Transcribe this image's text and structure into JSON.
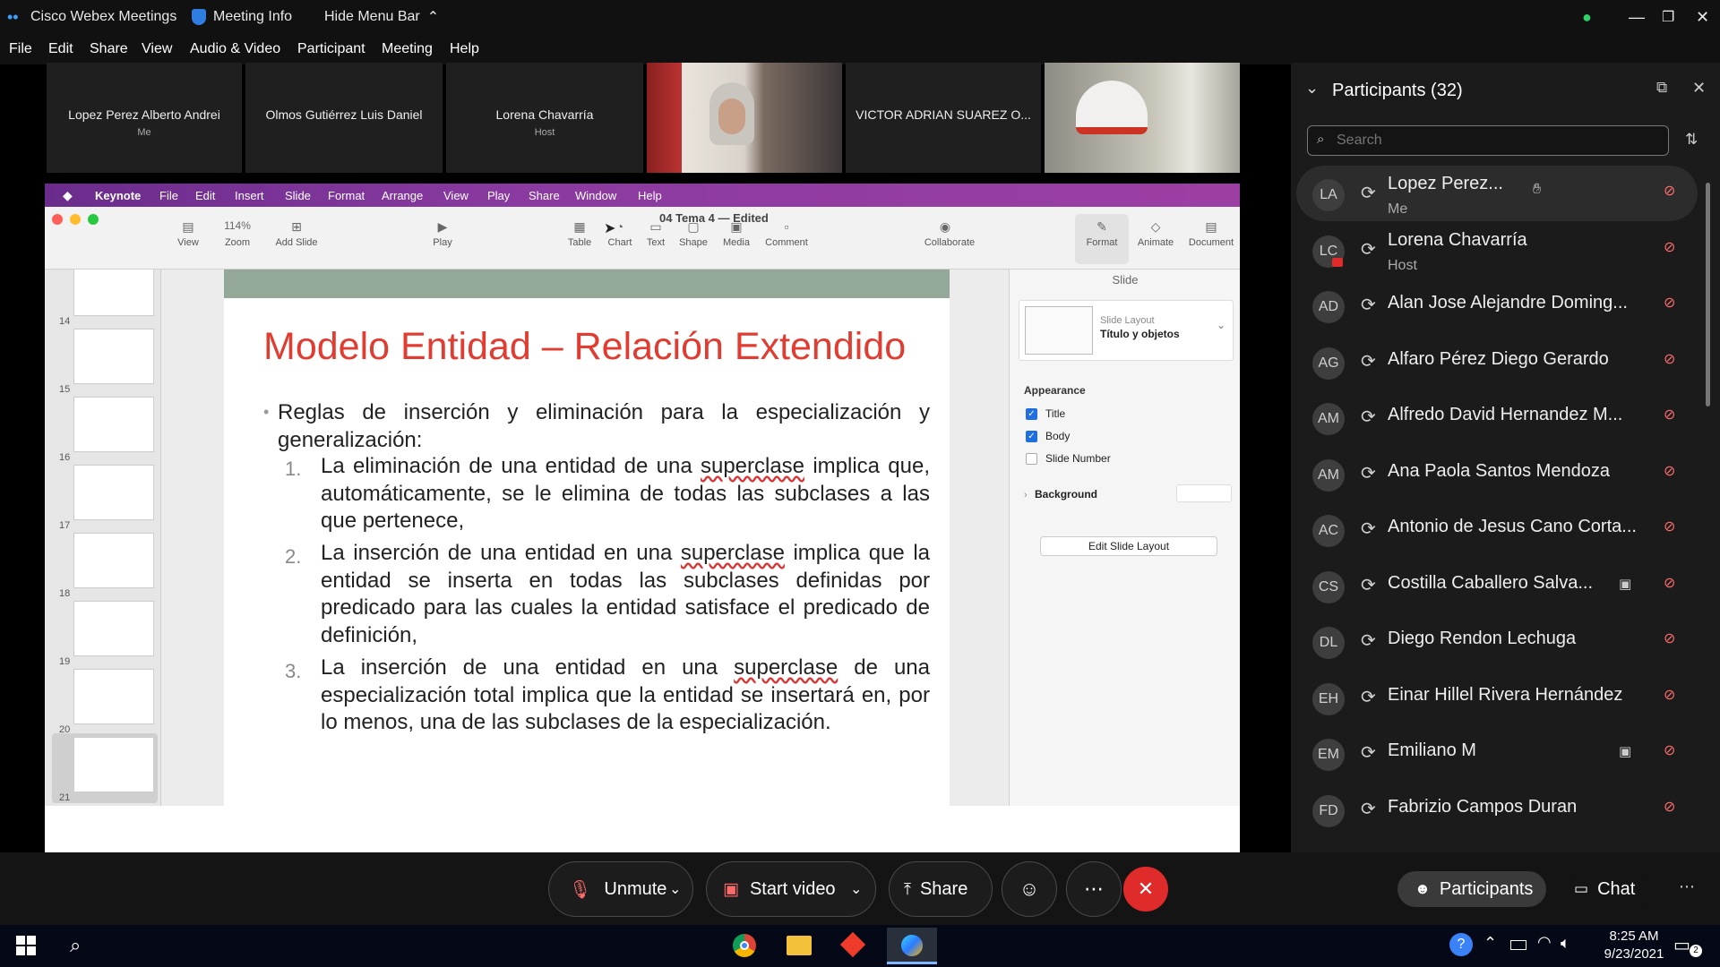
{
  "titlebar": {
    "app_name": "Cisco Webex Meetings",
    "meeting_info": "Meeting Info",
    "hide_menu": "Hide Menu Bar"
  },
  "menu": [
    "File",
    "Edit",
    "Share",
    "View",
    "Audio & Video",
    "Participant",
    "Meeting",
    "Help"
  ],
  "video_tiles": [
    {
      "name": "Lopez Perez Alberto Andrei",
      "sub": "Me"
    },
    {
      "name": "Olmos Gutiérrez Luis Daniel",
      "sub": ""
    },
    {
      "name": "Lorena Chavarría",
      "sub": "Host"
    },
    {
      "name": "",
      "sub": ""
    },
    {
      "name": "VICTOR ADRIAN SUAREZ O...",
      "sub": ""
    },
    {
      "name": "",
      "sub": ""
    }
  ],
  "keynote": {
    "menu": [
      "Keynote",
      "File",
      "Edit",
      "Insert",
      "Slide",
      "Format",
      "Arrange",
      "View",
      "Play",
      "Share",
      "Window",
      "Help"
    ],
    "doc_title": "04 Tema 4 — Edited",
    "toolbar": {
      "zoom_value": "114%",
      "view": "View",
      "zoom": "Zoom",
      "add_slide": "Add Slide",
      "play": "Play",
      "table": "Table",
      "chart": "Chart",
      "text": "Text",
      "shape": "Shape",
      "media": "Media",
      "comment": "Comment",
      "collaborate": "Collaborate",
      "format": "Format",
      "animate": "Animate",
      "document": "Document"
    },
    "thumb_numbers": [
      "14",
      "15",
      "16",
      "17",
      "18",
      "19",
      "20",
      "21"
    ],
    "slide": {
      "title": "Modelo Entidad – Relación Extendido",
      "bullet": "Reglas de inserción y eliminación para la especialización y generalización:",
      "items": [
        {
          "num": "1.",
          "a": "La eliminación de una entidad de una ",
          "sq": "superclase",
          "b": " implica que, automáticamente, se le elimina de todas las subclases a las que pertenece,"
        },
        {
          "num": "2.",
          "a": "La inserción de una entidad en una ",
          "sq": "superclase",
          "b": " implica que la entidad se inserta en todas las subclases definidas por predicado para las cuales la entidad satisface el predicado de definición,"
        },
        {
          "num": "3.",
          "a": "La inserción de una entidad en una ",
          "sq": "superclase",
          "b": " de una especialización total implica que la entidad se insertará en, por lo menos, una de las subclases de la especialización."
        }
      ]
    },
    "inspector": {
      "tab": "Slide",
      "layout_label": "Slide Layout",
      "layout_value": "Título y objetos",
      "appearance": "Appearance",
      "title_chk": "Title",
      "body_chk": "Body",
      "slide_number_chk": "Slide Number",
      "background": "Background",
      "edit_layout": "Edit Slide Layout"
    }
  },
  "participants_panel": {
    "title": "Participants (32)",
    "search_placeholder": "Search",
    "list": [
      {
        "initials": "LA",
        "name": "Lopez Perez...",
        "sub": "Me",
        "video": false
      },
      {
        "initials": "LC",
        "name": "Lorena Chavarría",
        "sub": "Host",
        "video": false
      },
      {
        "initials": "AD",
        "name": "Alan Jose Alejandre Doming...",
        "sub": "",
        "video": false
      },
      {
        "initials": "AG",
        "name": "Alfaro Pérez Diego Gerardo",
        "sub": "",
        "video": false
      },
      {
        "initials": "AM",
        "name": "Alfredo David Hernandez M...",
        "sub": "",
        "video": false
      },
      {
        "initials": "AM",
        "name": "Ana Paola Santos Mendoza",
        "sub": "",
        "video": false
      },
      {
        "initials": "AC",
        "name": "Antonio de Jesus Cano Corta...",
        "sub": "",
        "video": false
      },
      {
        "initials": "CS",
        "name": "Costilla Caballero Salva...",
        "sub": "",
        "video": true
      },
      {
        "initials": "DL",
        "name": "Diego Rendon Lechuga",
        "sub": "",
        "video": false
      },
      {
        "initials": "EH",
        "name": "Einar Hillel Rivera Hernández",
        "sub": "",
        "video": false
      },
      {
        "initials": "EM",
        "name": "Emiliano M",
        "sub": "",
        "video": true
      },
      {
        "initials": "FD",
        "name": "Fabrizio Campos Duran",
        "sub": "",
        "video": false
      }
    ]
  },
  "controls": {
    "unmute": "Unmute",
    "start_video": "Start video",
    "share": "Share",
    "participants": "Participants",
    "chat": "Chat"
  },
  "taskbar": {
    "time": "8:25 AM",
    "date": "9/23/2021",
    "notif_count": "2"
  },
  "colors": {
    "accent_red": "#e02b2b",
    "slide_title": "#e03c31",
    "panel_bg": "#1b1b1b"
  }
}
